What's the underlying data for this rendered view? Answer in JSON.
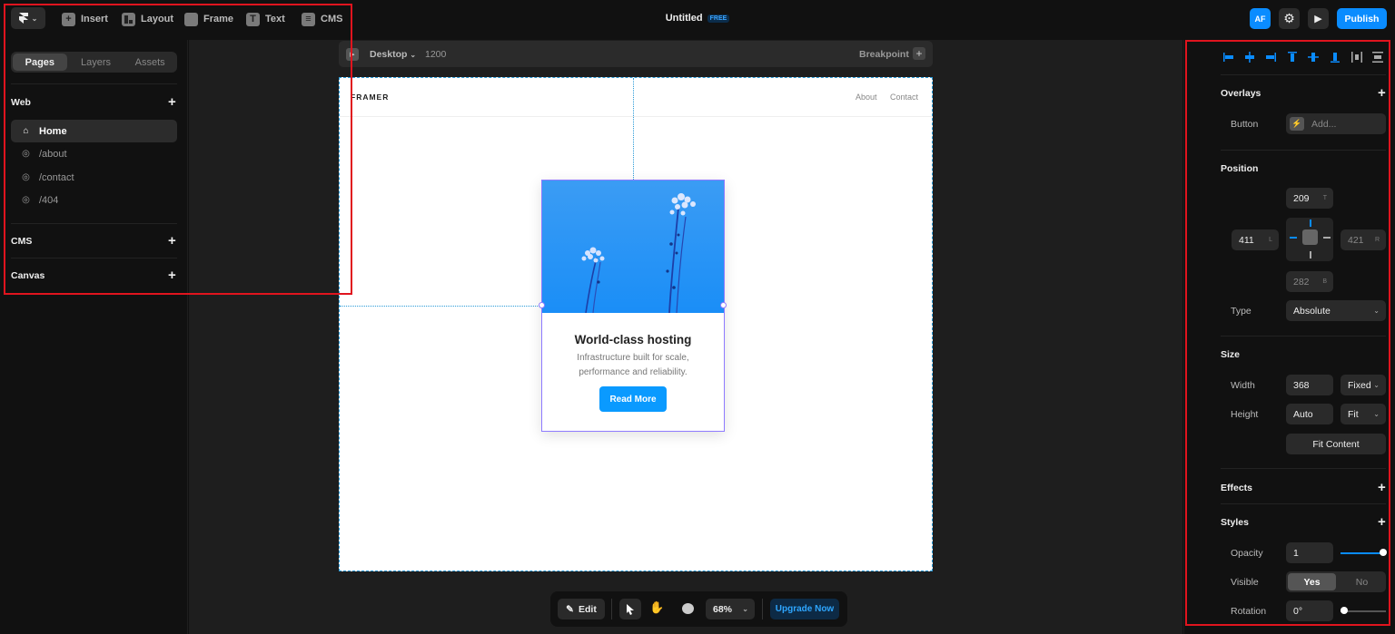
{
  "topbar": {
    "insert": "Insert",
    "layout": "Layout",
    "frame": "Frame",
    "text": "Text",
    "cms": "CMS",
    "title": "Untitled",
    "badge": "FREE",
    "avatar": "AF",
    "publish": "Publish"
  },
  "sidebar": {
    "tabs": [
      "Pages",
      "Layers",
      "Assets"
    ],
    "web_section": "Web",
    "pages": [
      "Home",
      "/about",
      "/contact",
      "/404"
    ],
    "cms_section": "CMS",
    "canvas_section": "Canvas"
  },
  "canvas": {
    "breakpoint_device": "Desktop",
    "breakpoint_width": "1200",
    "breakpoint_label": "Breakpoint",
    "site_logo": "FRAMER",
    "nav_links": [
      "About",
      "Contact"
    ],
    "card": {
      "title": "World-class hosting",
      "description_line1": "Infrastructure built for scale,",
      "description_line2": "performance and reliability.",
      "button": "Read More"
    }
  },
  "bottombar": {
    "edit": "Edit",
    "zoom": "68%",
    "upgrade": "Upgrade Now"
  },
  "rightpanel": {
    "overlays": {
      "heading": "Overlays",
      "button_label": "Button",
      "button_value": "Add..."
    },
    "position": {
      "heading": "Position",
      "top": "209",
      "top_suffix": "T",
      "left": "411",
      "left_suffix": "L",
      "right": "421",
      "right_suffix": "R",
      "bottom": "282",
      "bottom_suffix": "B",
      "type_label": "Type",
      "type_value": "Absolute"
    },
    "size": {
      "heading": "Size",
      "width_label": "Width",
      "width_value": "368",
      "width_mode": "Fixed",
      "height_label": "Height",
      "height_value": "Auto",
      "height_mode": "Fit",
      "fit_content": "Fit Content"
    },
    "effects": {
      "heading": "Effects"
    },
    "styles": {
      "heading": "Styles",
      "opacity_label": "Opacity",
      "opacity_value": "1",
      "visible_label": "Visible",
      "visible_yes": "Yes",
      "visible_no": "No",
      "rotation_label": "Rotation",
      "rotation_value": "0°"
    }
  },
  "colors": {
    "accent": "#0a8cff",
    "selection": "#8f7bff",
    "annotation": "#e0141e"
  }
}
